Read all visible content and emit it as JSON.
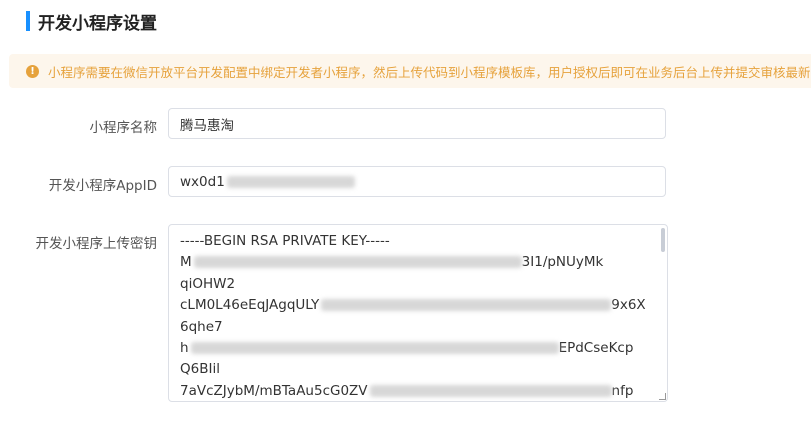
{
  "header": {
    "title": "开发小程序设置"
  },
  "notice": {
    "icon": "warning-icon",
    "text": "小程序需要在微信开放平台开发配置中绑定开发者小程序，然后上传代码到小程序模板库，用户授权后即可在业务后台上传并提交审核最新"
  },
  "form": {
    "name": {
      "label": "小程序名称",
      "value": "腾马惠淘"
    },
    "appid": {
      "label": "开发小程序AppID",
      "value_prefix": "wx0d1"
    },
    "secret": {
      "label": "开发小程序上传密钥",
      "lines": [
        {
          "text": "-----BEGIN RSA PRIVATE KEY-----"
        },
        {
          "text": "M",
          "tail": "3I1/pNUyMk"
        },
        {
          "text": "qiOHW2"
        },
        {
          "text": "cLM0L46eEqJAgqULY",
          "tail": "9x6X"
        },
        {
          "text": "6qhe7"
        },
        {
          "text": "h",
          "tail": "EPdCseKcp"
        },
        {
          "text": "Q6BIil"
        },
        {
          "text": "7aVcZJybM/mBTaAu5cG0ZV",
          "tail": "nfp"
        }
      ]
    }
  },
  "colors": {
    "accent": "#1890ff",
    "warning": "#e6a23c",
    "notice_bg": "#fdf6ec",
    "border": "#dcdfe6"
  }
}
